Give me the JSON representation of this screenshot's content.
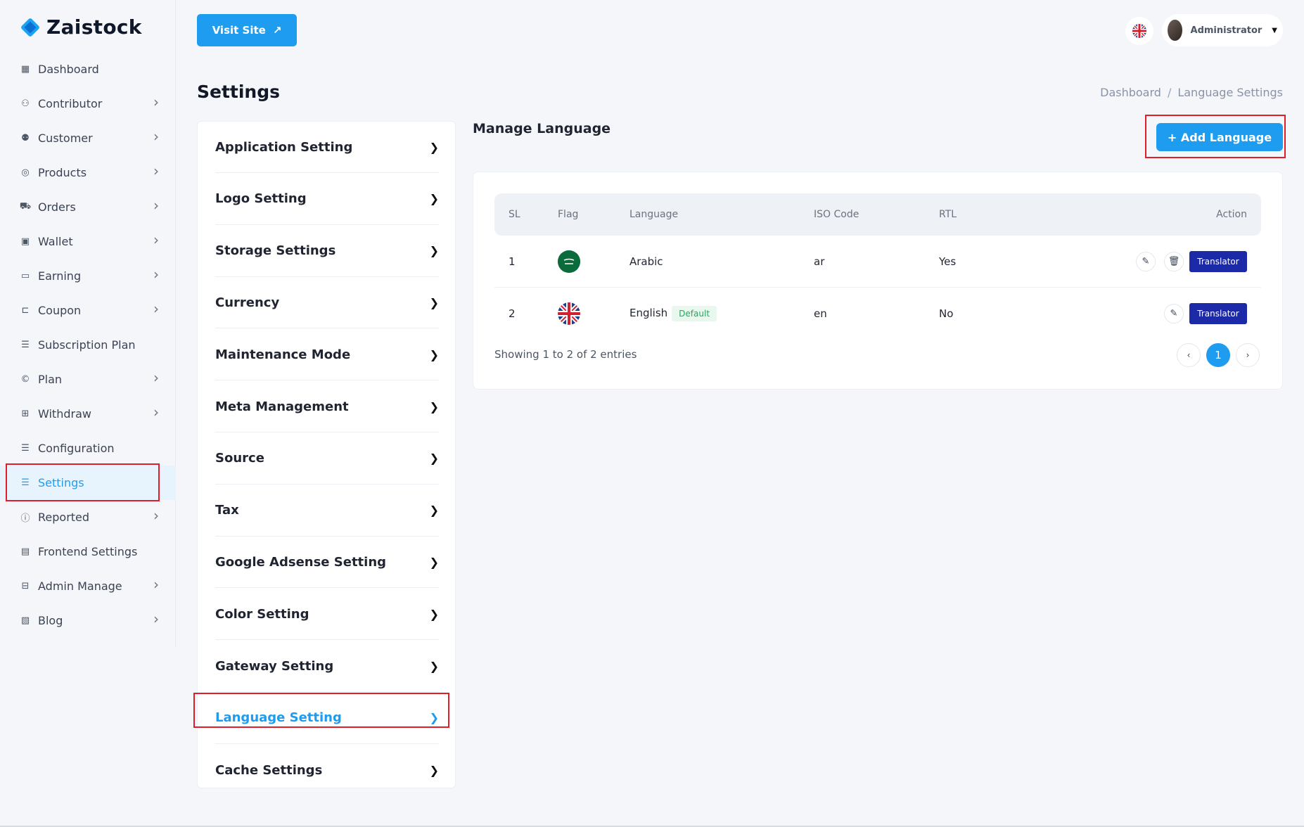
{
  "brand": {
    "name": "Zaistock"
  },
  "sidebar": {
    "items": [
      {
        "label": "Dashboard",
        "icon": "dashboard-icon",
        "glyph": "▦",
        "has_arrow": false
      },
      {
        "label": "Contributor",
        "icon": "contributor-icon",
        "glyph": "⚇",
        "has_arrow": true
      },
      {
        "label": "Customer",
        "icon": "customer-icon",
        "glyph": "⚉",
        "has_arrow": true
      },
      {
        "label": "Products",
        "icon": "products-icon",
        "glyph": "◎",
        "has_arrow": true
      },
      {
        "label": "Orders",
        "icon": "cart-icon",
        "glyph": "⛟",
        "has_arrow": true
      },
      {
        "label": "Wallet",
        "icon": "wallet-icon",
        "glyph": "▣",
        "has_arrow": true
      },
      {
        "label": "Earning",
        "icon": "earning-icon",
        "glyph": "▭",
        "has_arrow": true
      },
      {
        "label": "Coupon",
        "icon": "coupon-icon",
        "glyph": "⊏",
        "has_arrow": true
      },
      {
        "label": "Subscription Plan",
        "icon": "subscription-icon",
        "glyph": "☰",
        "has_arrow": false
      },
      {
        "label": "Plan",
        "icon": "plan-icon",
        "glyph": "©",
        "has_arrow": true
      },
      {
        "label": "Withdraw",
        "icon": "withdraw-icon",
        "glyph": "⊞",
        "has_arrow": true
      },
      {
        "label": "Configuration",
        "icon": "configuration-icon",
        "glyph": "☰",
        "has_arrow": false
      },
      {
        "label": "Settings",
        "icon": "settings-icon",
        "glyph": "☰",
        "has_arrow": false,
        "active": true
      },
      {
        "label": "Reported",
        "icon": "reported-icon",
        "glyph": "ⓘ",
        "has_arrow": true
      },
      {
        "label": "Frontend Settings",
        "icon": "frontend-icon",
        "glyph": "▤",
        "has_arrow": false
      },
      {
        "label": "Admin Manage",
        "icon": "admin-icon",
        "glyph": "⊟",
        "has_arrow": true
      },
      {
        "label": "Blog",
        "icon": "blog-icon",
        "glyph": "▧",
        "has_arrow": true
      }
    ]
  },
  "header": {
    "visit_site": "Visit Site",
    "user_name": "Administrator"
  },
  "page": {
    "title": "Settings",
    "breadcrumb": [
      "Dashboard",
      "Language Settings"
    ]
  },
  "settings_menu": [
    "Application Setting",
    "Logo Setting",
    "Storage Settings",
    "Currency",
    "Maintenance Mode",
    "Meta Management",
    "Source",
    "Tax",
    "Google Adsense Setting",
    "Color Setting",
    "Gateway Setting",
    "Language Setting",
    "Cache Settings"
  ],
  "settings_active": "Language Setting",
  "main": {
    "title": "Manage Language",
    "add_button": "+ Add Language",
    "columns": [
      "SL",
      "Flag",
      "Language",
      "ISO Code",
      "RTL",
      "Action"
    ],
    "rows": [
      {
        "sl": "1",
        "language": "Arabic",
        "iso": "ar",
        "rtl": "Yes",
        "default": false
      },
      {
        "sl": "2",
        "language": "English",
        "iso": "en",
        "rtl": "No",
        "default": true
      }
    ],
    "default_badge": "Default",
    "translator_label": "Translator",
    "showing": "Showing 1 to 2 of 2 entries",
    "pager": {
      "prev": "‹",
      "current": "1",
      "next": "›"
    }
  },
  "colors": {
    "accent": "#1e9cf0",
    "translator": "#1d2aa8",
    "highlight": "#e11d2a"
  }
}
